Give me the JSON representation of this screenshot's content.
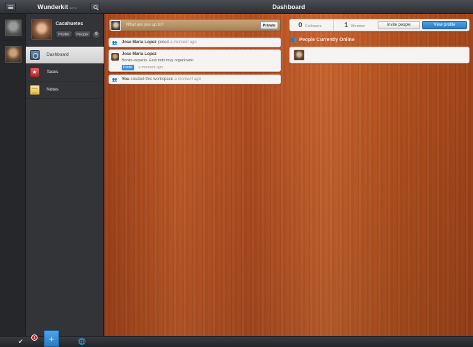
{
  "app": {
    "name": "Wunderkit",
    "version": "BETA",
    "page_title": "Dashboard"
  },
  "workspace": {
    "name": "Cacahuetes",
    "profile_label": "Profile",
    "people_label": "People"
  },
  "nav": {
    "items": [
      {
        "label": "Dashboard",
        "icon": "dashboard-icon",
        "active": true
      },
      {
        "label": "Tasks",
        "icon": "tasks-icon",
        "active": false
      },
      {
        "label": "Notes",
        "icon": "notes-icon",
        "active": false
      }
    ]
  },
  "composer": {
    "placeholder": "What are you up to?",
    "private_label": "Private"
  },
  "feed": [
    {
      "user": "Jose Maria Lopez",
      "action": "joined",
      "time": "a moment ago"
    },
    {
      "user": "Jose Maria Lopez",
      "body": "Bonito espacio. Está todo muy organizado.",
      "tag": "Public",
      "time": "a moment ago"
    },
    {
      "user": "You",
      "action": "created this workspace",
      "time": "a moment ago"
    }
  ],
  "stats": {
    "followers_count": "0",
    "followers_label": "Followers",
    "members_count": "1",
    "members_label": "Member",
    "invite_label": "Invite people",
    "view_profile_label": "View profile"
  },
  "online": {
    "heading": "People Currently Online"
  },
  "bottom": {
    "badge_count": "1"
  },
  "colors": {
    "accent": "#2a7bc4",
    "wood": "#b9541f",
    "badge": "#dd2222"
  }
}
